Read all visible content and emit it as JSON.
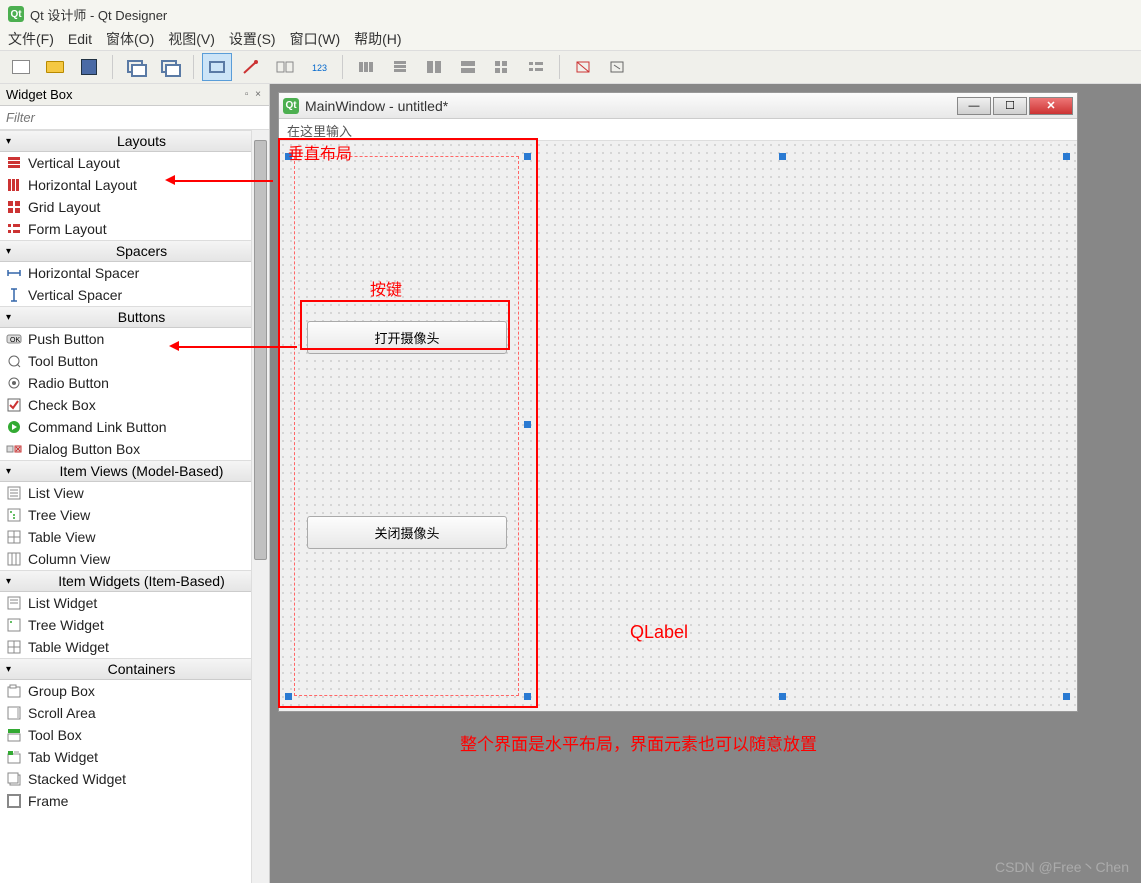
{
  "app": {
    "title": "Qt 设计师 - Qt Designer"
  },
  "menu": {
    "file": "文件(F)",
    "edit": "Edit",
    "form": "窗体(O)",
    "view": "视图(V)",
    "settings": "设置(S)",
    "window": "窗口(W)",
    "help": "帮助(H)"
  },
  "widgetbox": {
    "title": "Widget Box",
    "filter_placeholder": "Filter",
    "categories": {
      "layouts": {
        "label": "Layouts",
        "items": [
          "Vertical Layout",
          "Horizontal Layout",
          "Grid Layout",
          "Form Layout"
        ]
      },
      "spacers": {
        "label": "Spacers",
        "items": [
          "Horizontal Spacer",
          "Vertical Spacer"
        ]
      },
      "buttons": {
        "label": "Buttons",
        "items": [
          "Push Button",
          "Tool Button",
          "Radio Button",
          "Check Box",
          "Command Link Button",
          "Dialog Button Box"
        ]
      },
      "itemviews": {
        "label": "Item Views (Model-Based)",
        "items": [
          "List View",
          "Tree View",
          "Table View",
          "Column View"
        ]
      },
      "itemwidgets": {
        "label": "Item Widgets (Item-Based)",
        "items": [
          "List Widget",
          "Tree Widget",
          "Table Widget"
        ]
      },
      "containers": {
        "label": "Containers",
        "items": [
          "Group Box",
          "Scroll Area",
          "Tool Box",
          "Tab Widget",
          "Stacked Widget",
          "Frame"
        ]
      }
    }
  },
  "form_window": {
    "title": "MainWindow - untitled*",
    "menu_placeholder": "在这里输入",
    "button_open": "打开摄像头",
    "button_close": "关闭摄像头"
  },
  "annotations": {
    "vbox": "垂直布局",
    "button": "按键",
    "qlabel": "QLabel",
    "bottom": "整个界面是水平布局，界面元素也可以随意放置"
  },
  "watermark": "CSDN @Free丶Chen"
}
